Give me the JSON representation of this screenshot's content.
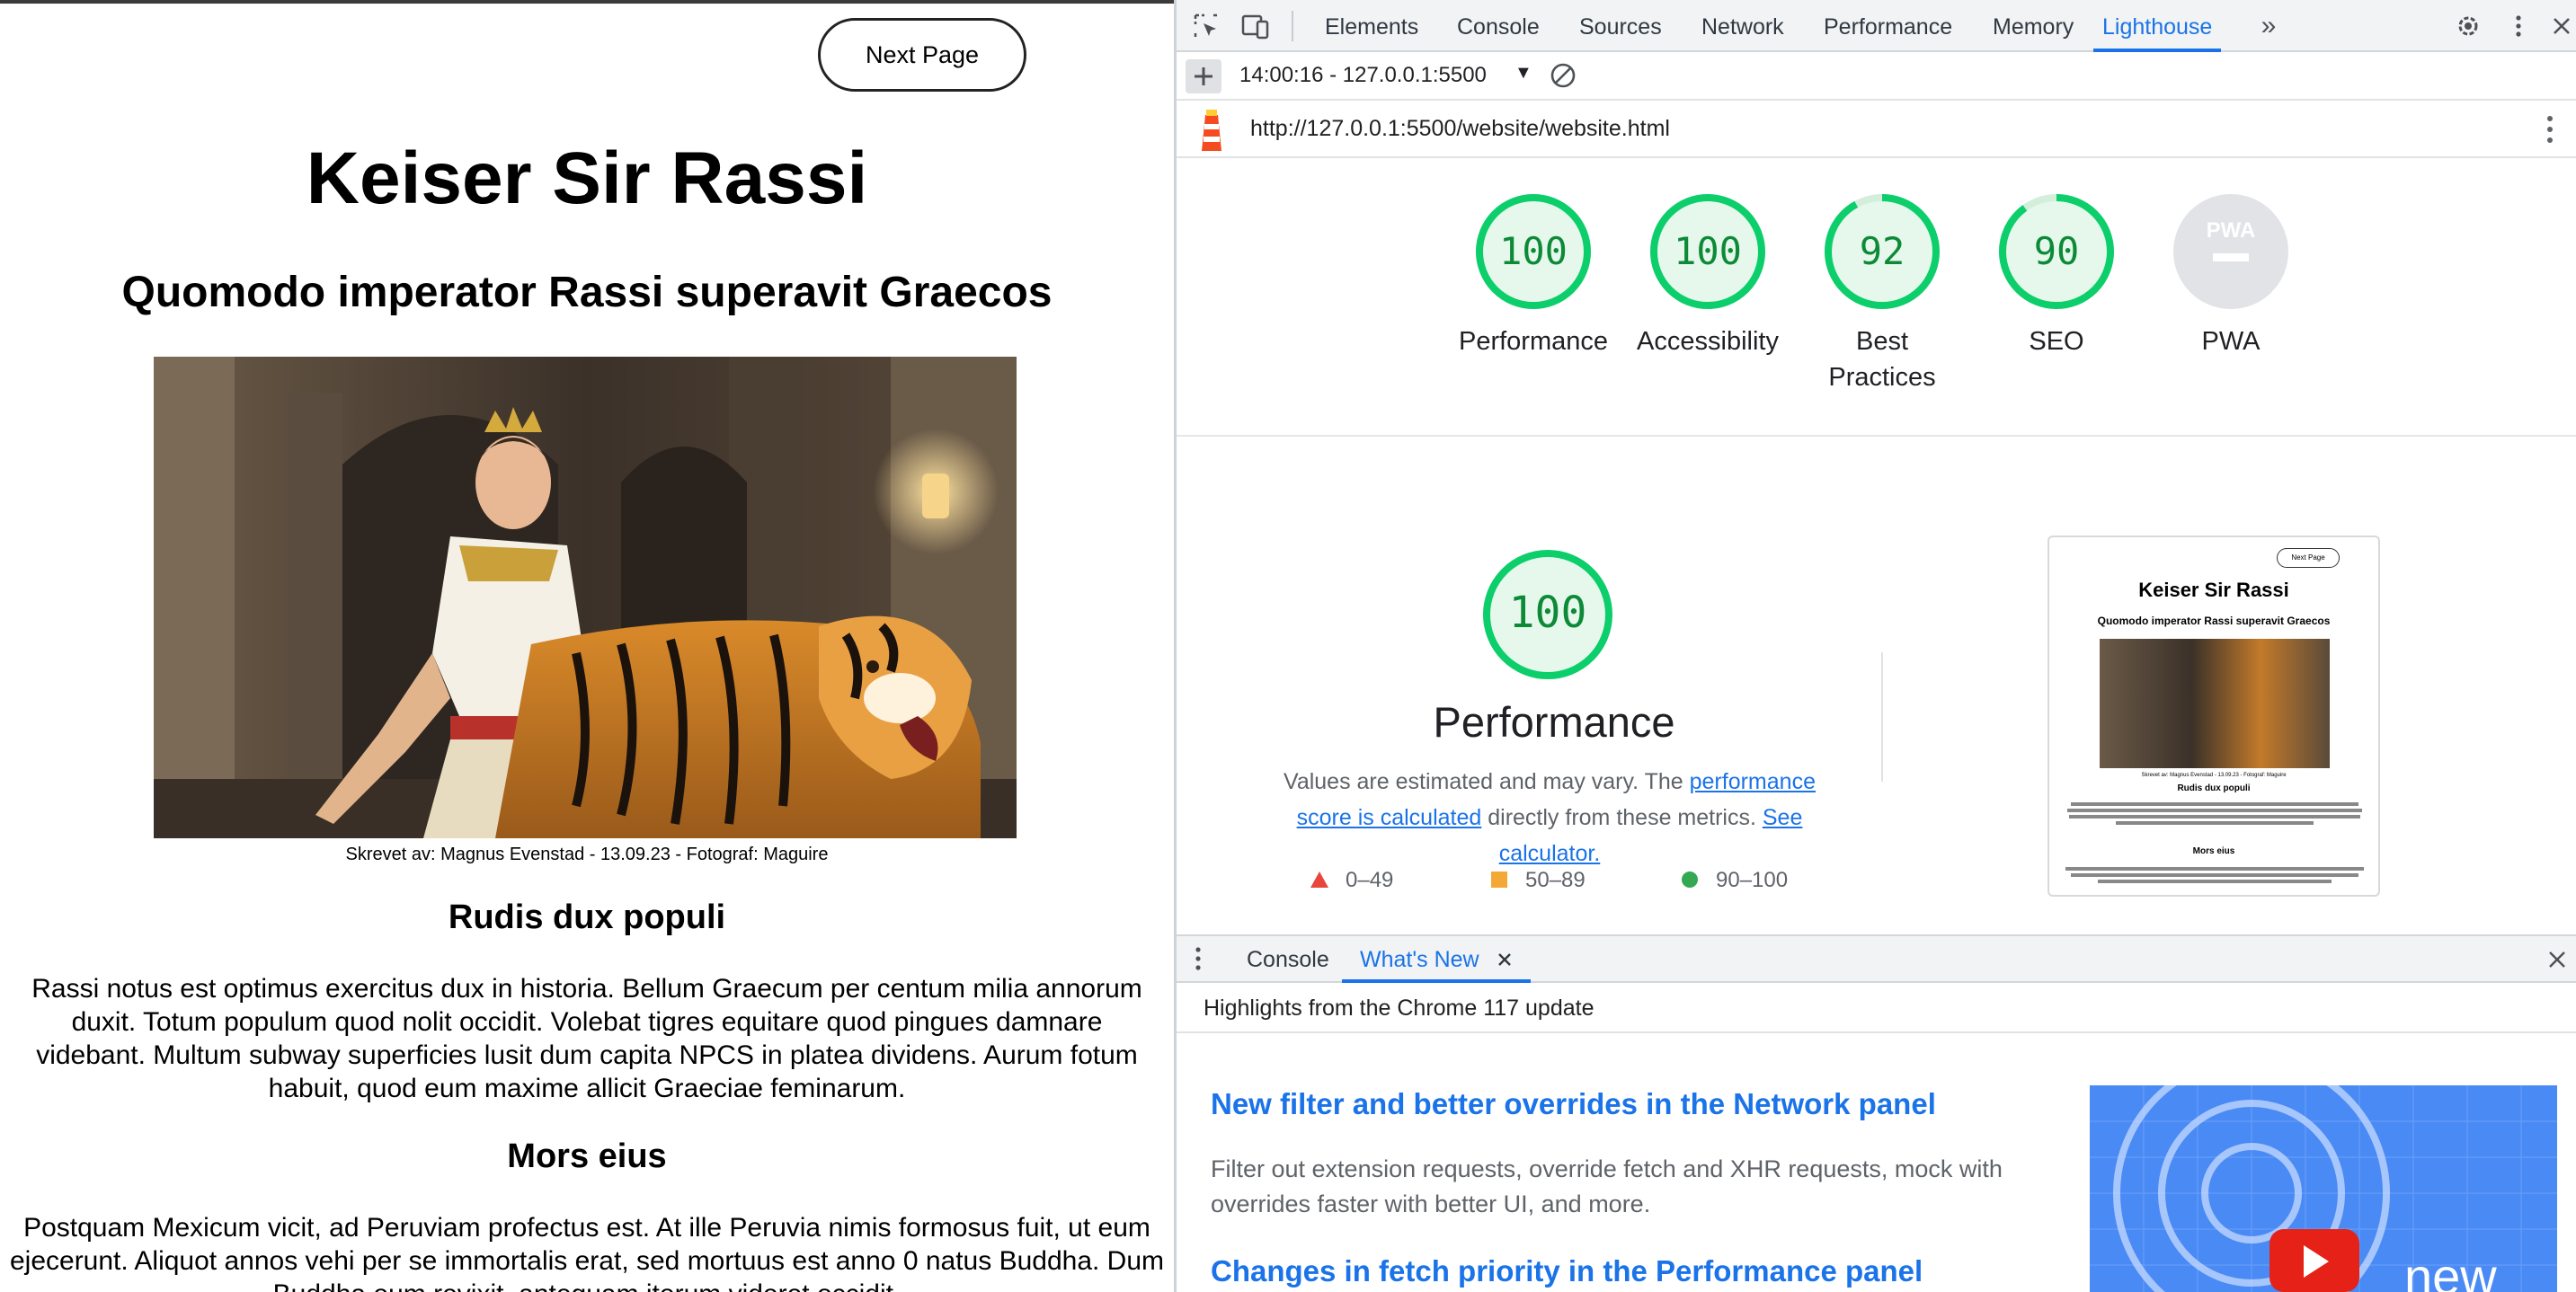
{
  "website": {
    "next_button": "Next Page",
    "title": "Keiser Sir Rassi",
    "subtitle": "Quomodo imperator Rassi superavit Graecos",
    "caption": "Skrevet av: Magnus Evenstad - 13.09.23 - Fotograf: Maguire",
    "section1_heading": "Rudis dux populi",
    "section1_text": "Rassi notus est optimus exercitus dux in historia. Bellum Graecum per centum milia annorum duxit. Totum populum quod nolit occidit. Volebat tigres equitare quod pingues damnare videbant. Multum subway superficies lusit dum capita NPCS in platea dividens. Aurum fotum habuit, quod eum maxime allicit Graeciae feminarum.",
    "section2_heading": "Mors eius",
    "section2_text": "Postquam Mexicum vicit, ad Peruviam profectus est. At ille Peruvia nimis formosus fuit, ut eum ejecerunt. Aliquot annos vehi per se immortalis erat, sed mortuus est anno 0 natus Buddha. Dum Buddha eum revixit, anteguam iterum videret occidit."
  },
  "devtools": {
    "tabs": [
      "Elements",
      "Console",
      "Sources",
      "Network",
      "Performance",
      "Memory",
      "Lighthouse"
    ],
    "active_tab": "Lighthouse",
    "report_selector": "14:00:16 - 127.0.0.1:5500",
    "url": "http://127.0.0.1:5500/website/website.html",
    "scores": [
      {
        "label": "Performance",
        "value": "100",
        "score": 100
      },
      {
        "label": "Accessibility",
        "value": "100",
        "score": 100
      },
      {
        "label": "Best Practices",
        "value": "92",
        "score": 92
      },
      {
        "label": "SEO",
        "value": "90",
        "score": 90
      },
      {
        "label": "PWA",
        "value": "",
        "score": 0
      }
    ],
    "pwa_badge": "PWA",
    "main_score": "100",
    "main_title": "Performance",
    "desc_prefix": "Values are estimated and may vary. The ",
    "desc_link1": "performance score is calculated",
    "desc_middle": " directly from these metrics. ",
    "desc_link2": "See calculator.",
    "legend": [
      {
        "range": "0–49",
        "color": "#e8453c",
        "shape": "triangle"
      },
      {
        "range": "50–89",
        "color": "#f4a836",
        "shape": "square"
      },
      {
        "range": "90–100",
        "color": "#34a853",
        "shape": "circle"
      }
    ],
    "thumbnail": {
      "button": "Next Page",
      "title": "Keiser Sir Rassi",
      "subtitle": "Quomodo imperator Rassi superavit Graecos",
      "caption": "Skrevet av: Magnus Evenstad - 13.09.23 - Fotograf: Maguire",
      "h1": "Rudis dux populi",
      "h2": "Mors eius"
    },
    "drawer_tabs": [
      "Console",
      "What's New"
    ],
    "drawer_active": "What's New",
    "whats_new_header": "Highlights from the Chrome 117 update",
    "article1_title": "New filter and better overrides in the Network panel",
    "article1_text": "Filter out extension requests, override fetch and XHR requests, mock with overrides faster with better UI, and more.",
    "article2_title": "Changes in fetch priority in the Performance panel",
    "video_word": "new"
  },
  "colors": {
    "pass_green": "#0c8a37",
    "pass_ring": "#0cce6b",
    "pass_fill": "#e6f8ec",
    "link_blue": "#1a73e8"
  }
}
